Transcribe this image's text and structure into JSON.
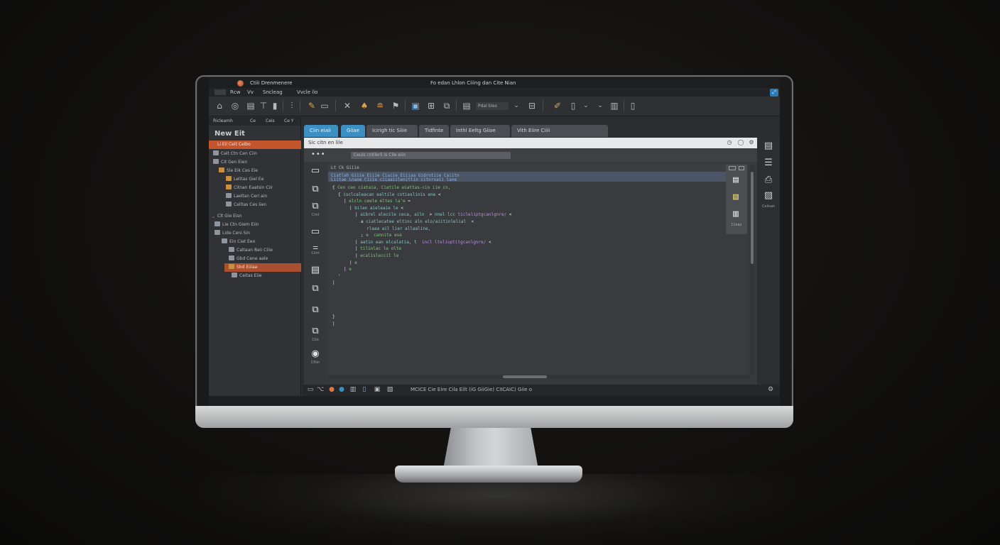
{
  "app": {
    "name": "Ctiii Drenmenere",
    "window_title": "Fo edan Lhlon Ciiing dan Cite Nian",
    "window_button": "⤢"
  },
  "menu": [
    {
      "label": "Rcw"
    },
    {
      "label": "Vv"
    },
    {
      "label": "Sncleag"
    },
    {
      "label": "Vvcle lio"
    }
  ],
  "toolbar": {
    "select_value": "Pdal bles"
  },
  "left_panel": {
    "tab_labels": [
      "Ricleamh",
      "Ce",
      "Ceis",
      "Ce Y"
    ],
    "heading": "New Eit",
    "tree": [
      {
        "label": "Li Eil Ceit Ceibo",
        "active": "primary"
      },
      {
        "label": "Ceit Ctn Cen Ciin"
      },
      {
        "label": "Cit Gen Eien"
      },
      {
        "label": "Sle Eik Ces Eie"
      },
      {
        "label": "Lelitas Giel Ee"
      },
      {
        "label": "Citnan Eaatsin Ciir"
      },
      {
        "label": "Laeltan Ceri ain"
      },
      {
        "label": "Celltas Ces iien"
      },
      {
        "label": "Clt Gie Eisn"
      },
      {
        "label": "Lie Ctn Giem Eiin"
      },
      {
        "label": "Lide Ceni Sin"
      },
      {
        "label": "Ein Ciat Eeo"
      },
      {
        "label": "Caltaan Beii Ciiie"
      },
      {
        "label": "Gbd Cene aale"
      },
      {
        "label": "Sbd Eiiiaa",
        "active": "secondary"
      },
      {
        "label": "Ceitas Eiie"
      }
    ]
  },
  "tabs": [
    {
      "label": "Ciin eiaii",
      "active": true
    },
    {
      "label": "Giiae",
      "active": true
    },
    {
      "label": "Icirigh tic   Siiie",
      "active": false
    },
    {
      "label": "Tidfinte",
      "active": false
    },
    {
      "label": "Inthl Eeltg   Giioe",
      "active": false
    },
    {
      "label": "Vith Eiire                    Ciiii",
      "active": false
    }
  ],
  "editor": {
    "title": "Sic citn en lile",
    "path_value": "Ceuls cntilerli is Cile eiin"
  },
  "side_icons": [
    {
      "label": ""
    },
    {
      "label": ""
    },
    {
      "label": "Ciinl"
    },
    {
      "label": ""
    },
    {
      "label": "Ciim"
    },
    {
      "label": ""
    },
    {
      "label": ""
    },
    {
      "label": ""
    },
    {
      "label": "Ciio"
    },
    {
      "label": "Cfiiin"
    }
  ],
  "code": {
    "header": "Lt Ck Giiie",
    "highlight_lines": [
      "Ciatlah Giiie Eiiie Ciaiie Eiiiaa Gidrntiie Caiitn",
      "Liitae Lnaoe Ciiie ciiaaiilenitlin citnrsaii lane"
    ],
    "lines": [
      {
        "indent": 0,
        "parts": [
          {
            "t": "{ ",
            "c": "white"
          },
          {
            "t": "Cen ceo ciataia, Ciatile eiattas-cio iie cn,",
            "c": "green"
          }
        ]
      },
      {
        "indent": 1,
        "parts": [
          {
            "t": "{ ",
            "c": "white"
          },
          {
            "t": "isclcaleacan ealtile cntieslinis ene ",
            "c": "teal"
          },
          {
            "t": "<",
            "c": "white"
          }
        ]
      },
      {
        "indent": 2,
        "parts": [
          {
            "t": "| ",
            "c": "white"
          },
          {
            "t": "elcln ceele eltes la'e ",
            "c": "green"
          },
          {
            "t": "=",
            "c": "white"
          }
        ]
      },
      {
        "indent": 3,
        "parts": [
          {
            "t": "| ",
            "c": "white"
          },
          {
            "t": "bilen aieleaie le ",
            "c": "teal"
          },
          {
            "t": "<",
            "c": "white"
          }
        ]
      },
      {
        "indent": 4,
        "parts": [
          {
            "t": "| ",
            "c": "white"
          },
          {
            "t": "aibrel alecile ceca, ailn  ",
            "c": "teal"
          },
          {
            "t": "> ",
            "c": "white"
          },
          {
            "t": "nnel lcc ",
            "c": "teal"
          },
          {
            "t": "ticleliptgcanlgnre/",
            "c": "purple"
          },
          {
            "t": " <",
            "c": "white"
          }
        ]
      },
      {
        "indent": 5,
        "parts": [
          {
            "t": "a ",
            "c": "white"
          },
          {
            "t": "ciatlecatee eltinc aln elo/aiitinlelial",
            "c": "teal"
          },
          {
            "t": "  <",
            "c": "white"
          }
        ]
      },
      {
        "indent": 6,
        "parts": [
          {
            "t": "rlaaa ail lier allaaline,",
            "c": "teal"
          }
        ]
      },
      {
        "indent": 5,
        "parts": [
          {
            "t": "; ",
            "c": "white"
          },
          {
            "t": "e  cannite ese",
            "c": "green"
          }
        ]
      },
      {
        "indent": 4,
        "parts": [
          {
            "t": "| ",
            "c": "white"
          },
          {
            "t": "aatin ean elcalatia, t",
            "c": "teal"
          },
          {
            "t": "  ",
            "c": "white"
          },
          {
            "t": "incl lteliuptitgcanlgnre/",
            "c": "purple"
          },
          {
            "t": " <",
            "c": "white"
          }
        ]
      },
      {
        "indent": 4,
        "parts": [
          {
            "t": "| ",
            "c": "white"
          },
          {
            "t": "tilinlac le olte",
            "c": "green"
          }
        ]
      },
      {
        "indent": 4,
        "parts": [
          {
            "t": "| ",
            "c": "white"
          },
          {
            "t": "ecalisleccil le",
            "c": "green"
          }
        ]
      },
      {
        "indent": 3,
        "parts": [
          {
            "t": "| ",
            "c": "white"
          },
          {
            "t": "e",
            "c": "green"
          }
        ]
      },
      {
        "indent": 2,
        "parts": [
          {
            "t": "| ",
            "c": "white"
          },
          {
            "t": "e",
            "c": "green"
          }
        ]
      },
      {
        "indent": 1,
        "parts": [
          {
            "t": "'",
            "c": "white"
          }
        ]
      },
      {
        "indent": 0,
        "parts": [
          {
            "t": "|",
            "c": "white"
          }
        ]
      },
      {
        "indent": 0,
        "parts": [
          {
            "t": "",
            "c": "white"
          }
        ]
      },
      {
        "indent": 0,
        "parts": [
          {
            "t": "",
            "c": "white"
          }
        ]
      },
      {
        "indent": 0,
        "parts": [
          {
            "t": "",
            "c": "white"
          }
        ]
      },
      {
        "indent": 0,
        "parts": [
          {
            "t": "",
            "c": "white"
          }
        ]
      },
      {
        "indent": 0,
        "parts": [
          {
            "t": "}",
            "c": "white"
          }
        ]
      },
      {
        "indent": 0,
        "parts": [
          {
            "t": "|",
            "c": "white"
          }
        ]
      }
    ]
  },
  "right_dock": {
    "label": "Ceiisan"
  },
  "mini_panel": {
    "label": "Cinai"
  },
  "status_bar": {
    "text": "MCICE Cie Eire Cila Eilt (iG GiiGie) CIICAIC) Giie o"
  },
  "colors": {
    "accent_orange": "#c2552c",
    "tab_active_blue": "#3b8fc3",
    "code_green": "#7ec97a",
    "code_purple": "#b690e0"
  }
}
